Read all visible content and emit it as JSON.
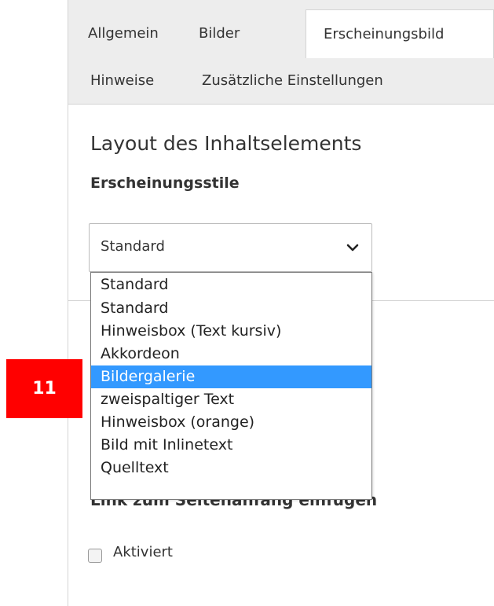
{
  "tabs": [
    {
      "label": "Allgemein",
      "active": false
    },
    {
      "label": "Bilder",
      "active": false
    },
    {
      "label": "Erscheinungsbild",
      "active": true
    },
    {
      "label": "Hinweise",
      "active": false
    },
    {
      "label": "Zusätzliche Einstellungen",
      "active": false
    }
  ],
  "section": {
    "title": "Layout des Inhaltselements"
  },
  "field": {
    "label": "Erscheinungsstile",
    "selected_value": "Standard",
    "chevron_icon": "chevron-down-icon"
  },
  "dropdown": {
    "options": [
      {
        "label": "Standard"
      },
      {
        "label": "Standard"
      },
      {
        "label": "Hinweisbox (Text kursiv)"
      },
      {
        "label": "Akkordeon"
      },
      {
        "label": "Bildergalerie",
        "highlighted": true
      },
      {
        "label": "zweispaltiger Text"
      },
      {
        "label": "Hinweisbox (orange)"
      },
      {
        "label": "Bild mit Inlinetext"
      },
      {
        "label": "Quelltext"
      }
    ],
    "highlight_color": "#3399ff"
  },
  "link_option": {
    "label": "Link zum Seitenanfang einfügen"
  },
  "checkbox": {
    "label": "Aktiviert",
    "checked": false
  },
  "annotation": {
    "badge": "11",
    "color": "#ff0000"
  }
}
